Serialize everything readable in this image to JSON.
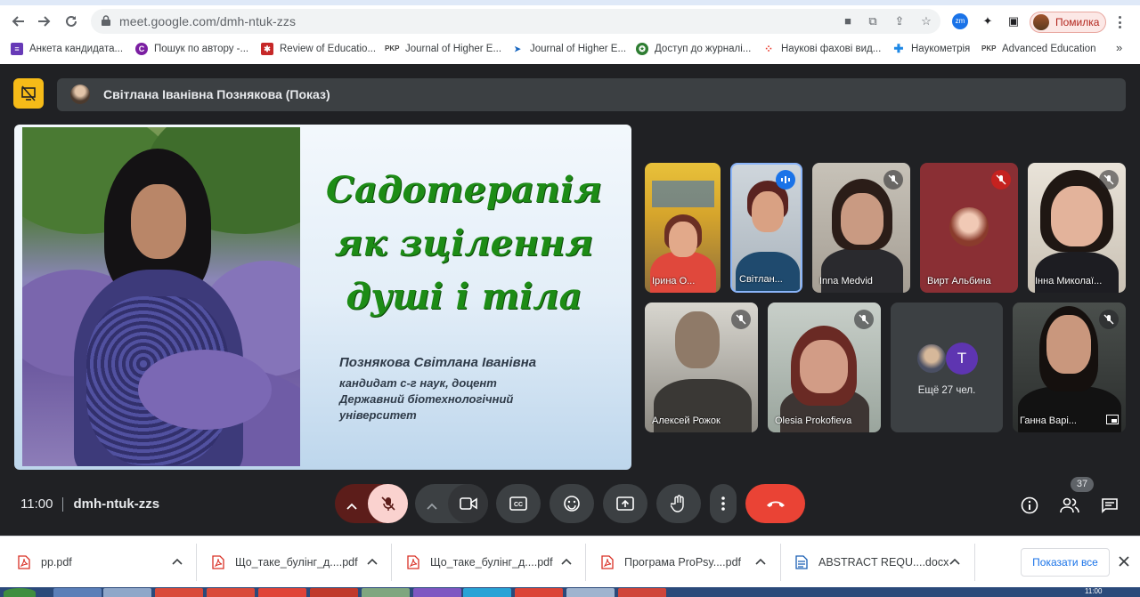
{
  "browser": {
    "url": "meet.google.com/dmh-ntuk-zzs",
    "profile_label": "Помилка",
    "bookmarks": [
      {
        "label": "Анкета кандидата...",
        "icon": "forms-icon",
        "color": "#673ab7"
      },
      {
        "label": "Пошук по автору -...",
        "icon": "publons-icon",
        "color": "#7b1fa2"
      },
      {
        "label": "Review of Educatio...",
        "icon": "journal-icon",
        "color": "#c62828"
      },
      {
        "label": "Journal of Higher E...",
        "icon": "pkp-icon",
        "color": "#444444"
      },
      {
        "label": "Journal of Higher E...",
        "icon": "arrow-icon",
        "color": "#1565c0"
      },
      {
        "label": "Доступ до журналі...",
        "icon": "emblem-icon",
        "color": "#2e7d32"
      },
      {
        "label": "Наукові фахові вид...",
        "icon": "dots-icon",
        "color": "#ea4335"
      },
      {
        "label": "Наукометрія",
        "icon": "cross-icon",
        "color": "#1e88e5"
      },
      {
        "label": "Advanced Education",
        "icon": "pkp-icon",
        "color": "#444444"
      }
    ],
    "more_bookmarks": "»"
  },
  "meet": {
    "presenter_bar": "Світлана Іванівна Познякова (Показ)",
    "slide": {
      "title_lines": [
        "Садотерапія",
        "як зцілення",
        "душі і тіла"
      ],
      "author": "Познякова Світлана Іванівна",
      "info_lines": [
        "кандидат с-г наук, доцент",
        "Державний біотехнологічний",
        "університет"
      ]
    },
    "participants": [
      {
        "name": "Ірина О...",
        "muted": false
      },
      {
        "name": "Світлан...",
        "muted": false,
        "speaking": true
      },
      {
        "name": "Inna Medvid",
        "muted": true
      },
      {
        "name": "Вирт Альбина",
        "muted": true
      },
      {
        "name": "Інна Миколаї...",
        "muted": true
      },
      {
        "name": "Алексей Рожок",
        "muted": true
      },
      {
        "name": "Olesia Prokofieva",
        "muted": true
      },
      {
        "name": "Ганна Варі...",
        "muted": true
      }
    ],
    "more_people": {
      "avatar_letter": "T",
      "label": "Ещё 27 чел."
    },
    "time": "11:00",
    "meeting_code": "dmh-ntuk-zzs",
    "participant_count": "37"
  },
  "downloads": {
    "files": [
      {
        "name": "pp.pdf",
        "type": "pdf"
      },
      {
        "name": "Що_таке_булінг_д....pdf",
        "type": "pdf"
      },
      {
        "name": "Що_таке_булінг_д....pdf",
        "type": "pdf"
      },
      {
        "name": "Програма ProPsy....pdf",
        "type": "pdf"
      },
      {
        "name": "ABSTRACT REQU....docx",
        "type": "docx"
      }
    ],
    "show_all": "Показати все"
  },
  "taskbar": {
    "clock": "11:00"
  }
}
